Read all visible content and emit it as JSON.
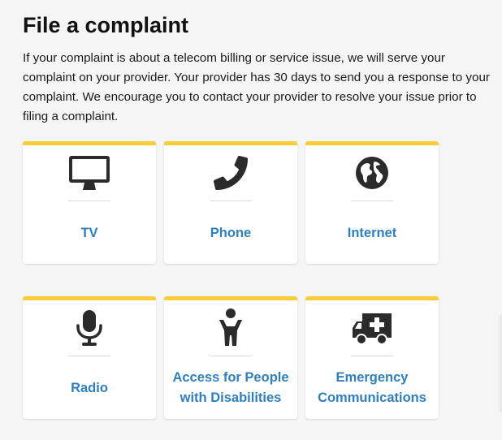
{
  "page": {
    "title": "File a complaint",
    "intro": "If your complaint is about a telecom billing or service issue, we will serve your complaint on your provider. Your provider has 30 days to send you a response to your complaint. We encourage you to contact your provider to resolve your issue prior to filing a complaint."
  },
  "accent_color": "#fbcd3a",
  "link_color": "#2e7fbf",
  "categories": [
    {
      "label": "TV",
      "icon": "tv-monitor-icon"
    },
    {
      "label": "Phone",
      "icon": "phone-handset-icon"
    },
    {
      "label": "Internet",
      "icon": "globe-icon"
    },
    {
      "label": "Radio",
      "icon": "microphone-icon"
    },
    {
      "label": "Access for People with Disabilities",
      "icon": "person-icon"
    },
    {
      "label": "Emergency Communications",
      "icon": "ambulance-icon"
    }
  ]
}
